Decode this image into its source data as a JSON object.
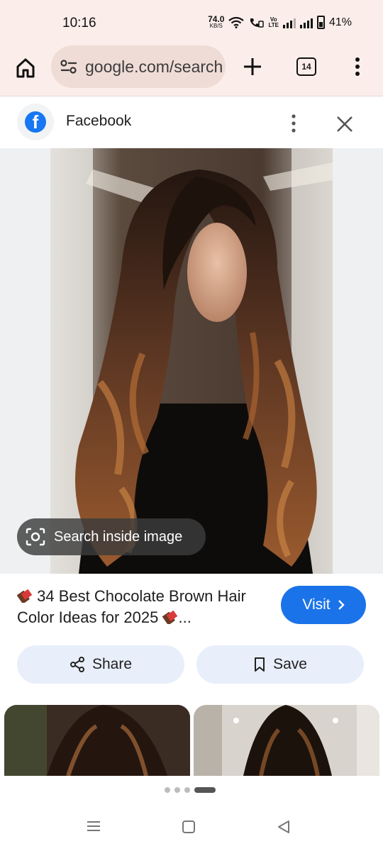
{
  "status_bar": {
    "time": "10:16",
    "net_speed_value": "74.0",
    "net_speed_unit": "KB/S",
    "volte_top": "Vo",
    "volte_bottom": "LTE",
    "battery": "41%"
  },
  "toolbar": {
    "url": "google.com/search",
    "tab_count": "14"
  },
  "source": {
    "name": "Facebook"
  },
  "image": {
    "lens_label": "Search inside image"
  },
  "result": {
    "title": "34 Best Chocolate Brown Hair Color Ideas for 2025",
    "title_suffix": "...",
    "visit_label": "Visit"
  },
  "actions": {
    "share_label": "Share",
    "save_label": "Save"
  },
  "colors": {
    "accent_blue": "#1a73e8",
    "facebook_blue": "#1877f2",
    "toolbar_bg": "#fbeeea",
    "pill_bg": "#e8eefa"
  },
  "icons": {
    "home": "home-icon",
    "tune": "site-settings-icon",
    "plus": "new-tab-icon",
    "menu": "more-vert-icon",
    "close": "close-icon",
    "lens": "lens-camera-icon",
    "share": "share-icon",
    "save": "bookmark-icon",
    "chocolate": "chocolate-bar-emoji"
  }
}
